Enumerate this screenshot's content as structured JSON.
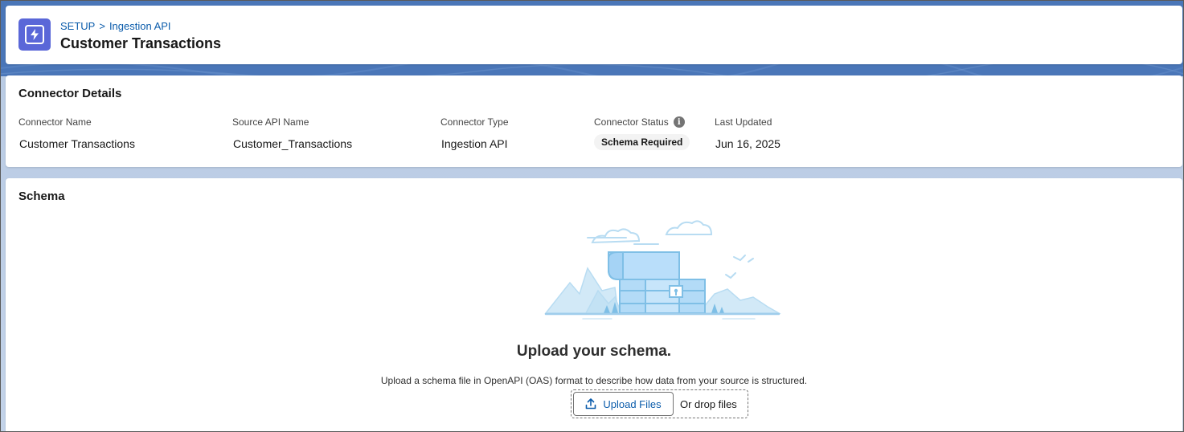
{
  "header": {
    "breadcrumb_root": "SETUP",
    "breadcrumb_separator": ">",
    "breadcrumb_current": "Ingestion API",
    "title": "Customer Transactions",
    "icon": "lightning-bolt-icon",
    "icon_color": "#5a67d8"
  },
  "details": {
    "section_title": "Connector Details",
    "fields": [
      {
        "label": "Connector Name",
        "value": "Customer Transactions"
      },
      {
        "label": "Source API Name",
        "value": "Customer_Transactions"
      },
      {
        "label": "Connector Type",
        "value": "Ingestion API"
      },
      {
        "label": "Connector Status",
        "value": "Schema Required"
      },
      {
        "label": "Last Updated",
        "value": "Jun 16, 2025"
      }
    ]
  },
  "schema": {
    "section_title": "Schema",
    "heading": "Upload your schema.",
    "description": "Upload a schema file in OpenAPI (OAS) format to describe how data from your source is structured.",
    "upload_button_label": "Upload Files",
    "drop_label": "Or drop files"
  },
  "colors": {
    "link": "#0b5cab",
    "illustration": "#9fcdeb"
  }
}
